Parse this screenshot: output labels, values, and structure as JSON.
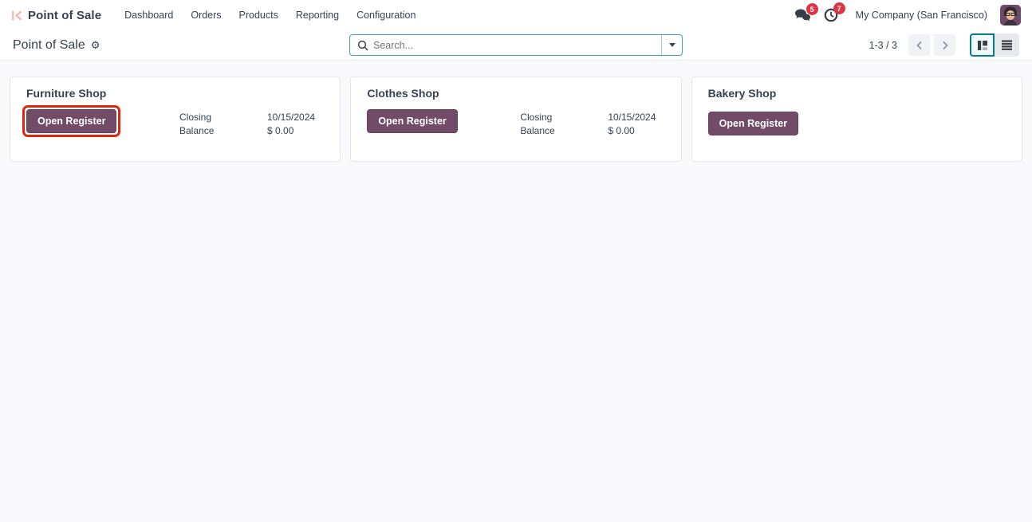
{
  "navbar": {
    "app_name": "Point of Sale",
    "menu_items": [
      "Dashboard",
      "Orders",
      "Products",
      "Reporting",
      "Configuration"
    ],
    "messages_badge": "5",
    "activities_badge": "7",
    "company_name": "My Company (San Francisco)"
  },
  "control_panel": {
    "breadcrumb_title": "Point of Sale",
    "search": {
      "placeholder": "Search..."
    },
    "pager": {
      "text": "1-3 / 3"
    }
  },
  "cards": [
    {
      "title": "Furniture Shop",
      "open_register_label": "Open Register",
      "highlighted": true,
      "closing_label": "Closing Balance",
      "closing_date": "10/15/2024",
      "closing_amount": "$ 0.00"
    },
    {
      "title": "Clothes Shop",
      "open_register_label": "Open Register",
      "highlighted": false,
      "closing_label": "Closing Balance",
      "closing_date": "10/15/2024",
      "closing_amount": "$ 0.00"
    },
    {
      "title": "Bakery Shop",
      "open_register_label": "Open Register",
      "highlighted": false
    }
  ],
  "colors": {
    "accent_teal": "#017e84",
    "primary_purple": "#714B67",
    "badge_red": "#dc3545",
    "highlight_red": "#e8220c",
    "text_dark": "#374151",
    "content_bg": "#f9f9fb"
  }
}
